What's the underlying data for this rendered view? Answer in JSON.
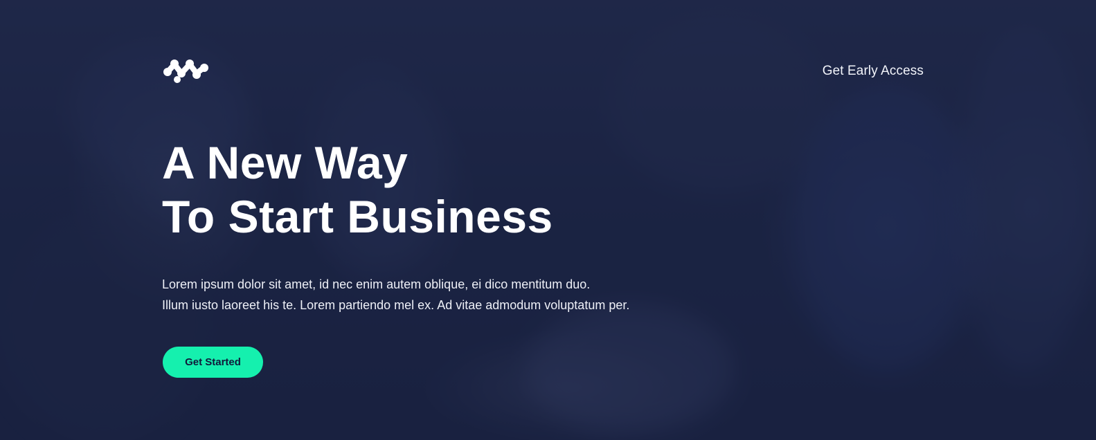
{
  "header": {
    "logo_icon": "brand-logo-icon",
    "nav_link_label": "Get Early Access"
  },
  "hero": {
    "headline_line1": "A New Way",
    "headline_line2": "To Start Business",
    "lead_line1": "Lorem ipsum dolor sit amet, id nec enim autem oblique, ei dico mentitum duo.",
    "lead_line2": "Illum iusto laoreet his te. Lorem partiendo mel ex. Ad vitae admodum voluptatum per.",
    "cta_label": "Get Started"
  },
  "colors": {
    "accent": "#15f0ae",
    "overlay": "#161e3c",
    "text": "#ffffff"
  }
}
